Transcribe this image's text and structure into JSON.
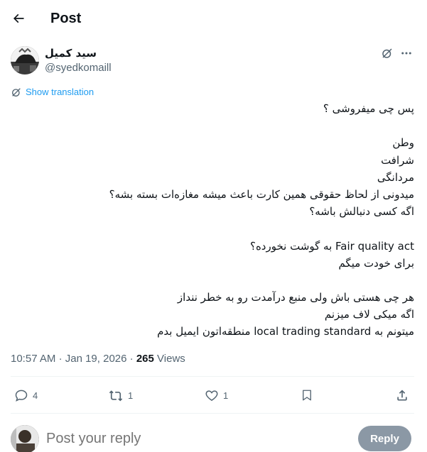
{
  "header": {
    "title": "Post"
  },
  "author": {
    "display_name": "سید کمیل",
    "handle": "@syedkomaill"
  },
  "translation_link": "Show translation",
  "tweet": {
    "lines": [
      "پس چی میفروشی ؟",
      "",
      "وطن",
      "شرافت",
      "مردانگی",
      "میدونی از لحاظ حقوقی همین کارت باعث میشه مغازه‌ات بسته بشه؟",
      "اگه کسی دنبالش باشه؟",
      "",
      "Fair quality act به گوشت نخورده؟",
      "برای خودت میگم",
      "",
      "هر چی هستی باش ولی منبع درآمدت رو به خطر ننداز",
      "اگه میکی لاف میزنم",
      "میتونم به local trading standard منطقه‌اتون ایمیل بدم"
    ]
  },
  "meta": {
    "time": "10:57 AM",
    "date": "Jan 19, 2026",
    "views_count": "265",
    "views_label": "Views"
  },
  "actions": {
    "replies": "4",
    "reposts": "1",
    "likes": "1"
  },
  "reply": {
    "placeholder": "Post your reply",
    "button_label": "Reply"
  },
  "icons": [
    "back-arrow-icon",
    "grok-icon",
    "more-icon",
    "translate-icon",
    "reply-icon",
    "repost-icon",
    "like-icon",
    "bookmark-icon",
    "share-icon"
  ],
  "colors": {
    "accent": "#1d9bf0",
    "secondary_text": "#536471",
    "reply_button_bg": "#8b98a5"
  }
}
